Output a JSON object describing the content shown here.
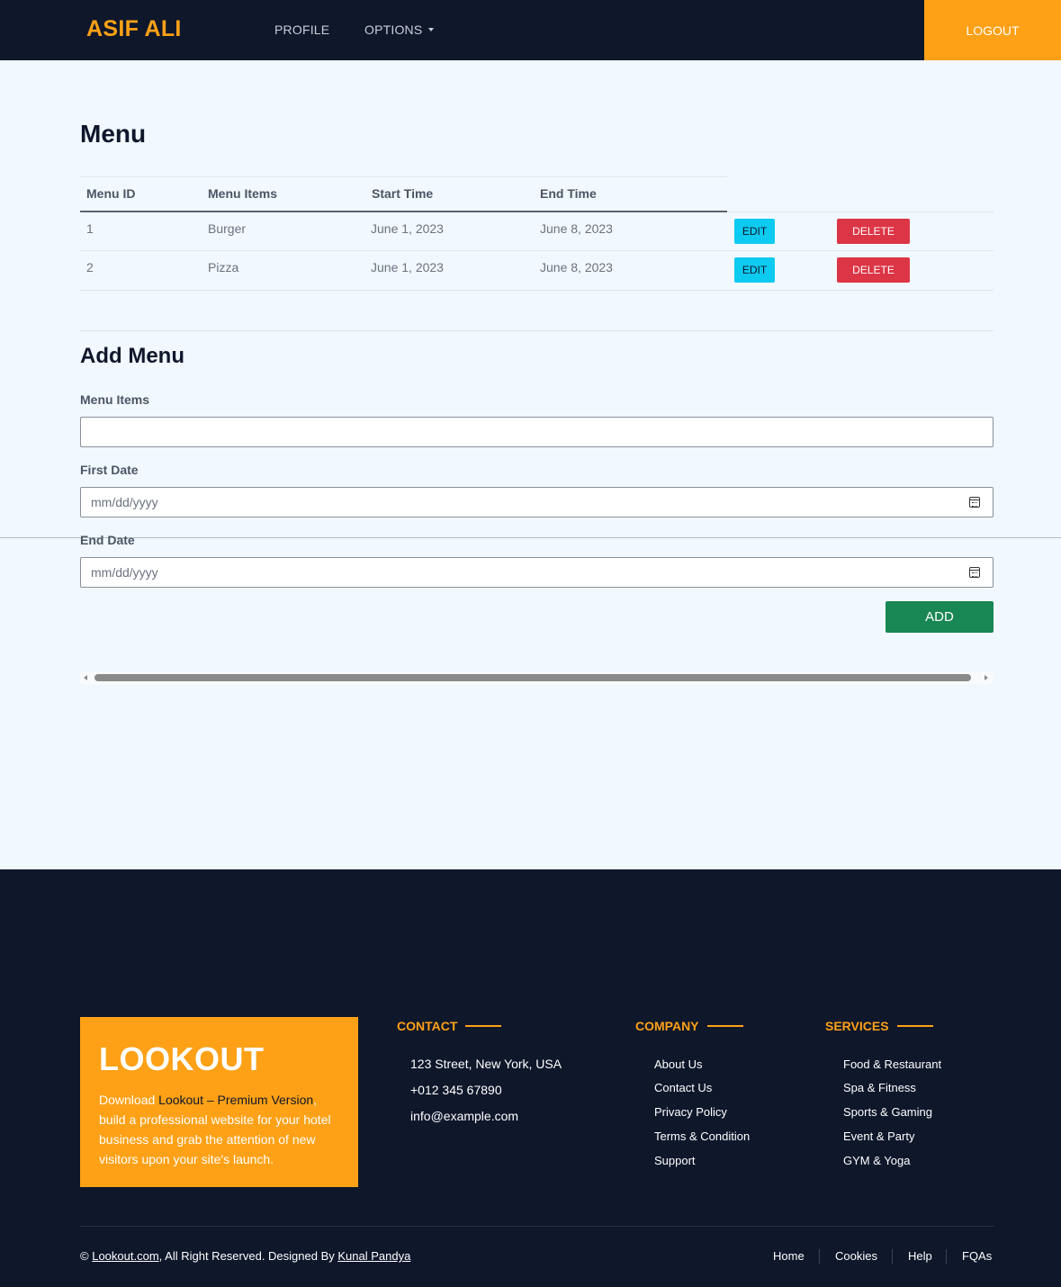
{
  "navbar": {
    "brand": "ASIF ALI",
    "profile": "PROFILE",
    "options": "OPTIONS",
    "logout": "LOGOUT"
  },
  "menu": {
    "title": "Menu",
    "headers": [
      "Menu ID",
      "Menu Items",
      "Start Time",
      "End Time"
    ],
    "rows": [
      {
        "id": "1",
        "item": "Burger",
        "start": "June 1, 2023",
        "end": "June 8, 2023",
        "edit": "EDIT",
        "delete": "DELETE"
      },
      {
        "id": "2",
        "item": "Pizza",
        "start": "June 1, 2023",
        "end": "June 8, 2023",
        "edit": "EDIT",
        "delete": "DELETE"
      }
    ]
  },
  "form": {
    "title": "Add Menu",
    "menu_items_label": "Menu Items",
    "menu_items_value": "",
    "first_date_label": "First Date",
    "first_date_placeholder": "mm/dd/yyyy",
    "end_date_label": "End Date",
    "end_date_placeholder": "mm/dd/yyyy",
    "add_button": "ADD"
  },
  "footer": {
    "promo": {
      "title": "LOOKOUT",
      "text_prefix": "Download ",
      "text_highlight": "Lookout – Premium Version",
      "text_suffix": ", build a professional website for your hotel business and grab the attention of new visitors upon your site's launch."
    },
    "contact": {
      "heading": "CONTACT",
      "address": "123 Street, New York, USA",
      "phone": "+012 345 67890",
      "email": "info@example.com"
    },
    "company": {
      "heading": "COMPANY",
      "links": [
        "About Us",
        "Contact Us",
        "Privacy Policy",
        "Terms & Condition",
        "Support"
      ]
    },
    "services": {
      "heading": "SERVICES",
      "links": [
        "Food & Restaurant",
        "Spa & Fitness",
        "Sports & Gaming",
        "Event & Party",
        "GYM & Yoga"
      ]
    },
    "copyright": {
      "symbol": "©",
      "site": "Lookout.com",
      "text": ", All Right Reserved. Designed By ",
      "designer": "Kunal Pandya"
    },
    "bottom_links": [
      "Home",
      "Cookies",
      "Help",
      "FQAs"
    ]
  },
  "colors": {
    "navy": "#0f172b",
    "accent": "#fea116",
    "edit": "#0dcaf0",
    "delete": "#dc3545",
    "add": "#198754"
  }
}
